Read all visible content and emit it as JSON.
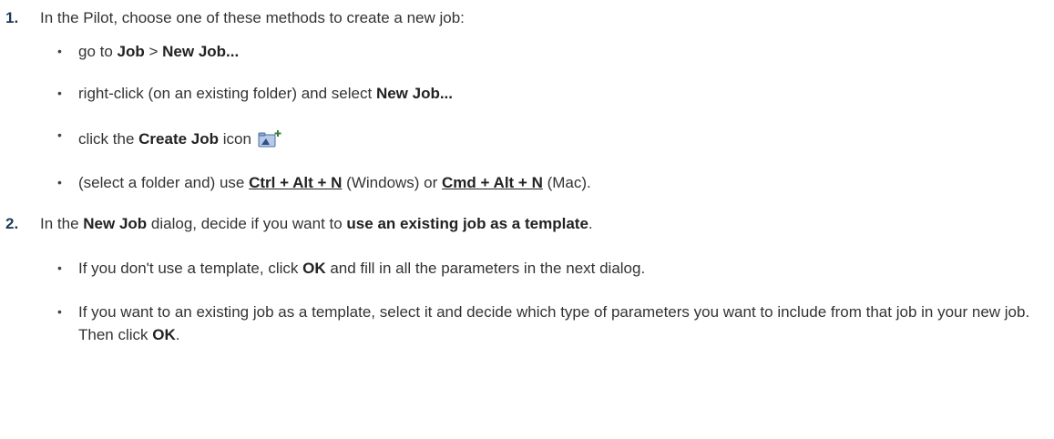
{
  "steps": [
    {
      "number": "1.",
      "text": "In the Pilot, choose one of these methods to create a new job:",
      "bullets": [
        {
          "parts": [
            {
              "t": "go to ",
              "s": "plain"
            },
            {
              "t": "Job",
              "s": "bold"
            },
            {
              "t": " > ",
              "s": "plain"
            },
            {
              "t": "New Job...",
              "s": "bold"
            }
          ]
        },
        {
          "parts": [
            {
              "t": "right-click (on an existing folder) and select ",
              "s": "plain"
            },
            {
              "t": "New Job...",
              "s": "bold"
            }
          ]
        },
        {
          "parts": [
            {
              "t": "click the ",
              "s": "plain"
            },
            {
              "t": "Create Job",
              "s": "bold"
            },
            {
              "t": " icon ",
              "s": "plain"
            }
          ],
          "icon": "create-job-icon"
        },
        {
          "parts": [
            {
              "t": "(select a folder and) use ",
              "s": "plain"
            },
            {
              "t": "Ctrl + Alt + N",
              "s": "kbd"
            },
            {
              "t": " (Windows) or ",
              "s": "plain"
            },
            {
              "t": "Cmd + Alt + N",
              "s": "kbd"
            },
            {
              "t": " (Mac).",
              "s": "plain"
            }
          ]
        }
      ]
    },
    {
      "number": "2.",
      "parts": [
        {
          "t": "In the ",
          "s": "plain"
        },
        {
          "t": "New Job",
          "s": "bold"
        },
        {
          "t": " dialog, decide if you want to ",
          "s": "plain"
        },
        {
          "t": "use an existing job as a template",
          "s": "bold"
        },
        {
          "t": ".",
          "s": "plain"
        }
      ],
      "bullets": [
        {
          "parts": [
            {
              "t": "If you don't use a template, click ",
              "s": "plain"
            },
            {
              "t": "OK",
              "s": "bold"
            },
            {
              "t": " and fill in all the parameters in the next dialog.",
              "s": "plain"
            }
          ]
        },
        {
          "parts": [
            {
              "t": "If you want to an existing job as a template, select it and decide which type of parameters you want to include from that job in your new job. Then click ",
              "s": "plain"
            },
            {
              "t": "OK",
              "s": "bold"
            },
            {
              "t": ".",
              "s": "plain"
            }
          ]
        }
      ]
    }
  ],
  "bullet_glyph": "•",
  "colors": {
    "text": "#333333",
    "step_number": "#1e3a5c",
    "icon_folder": "#6b8fbf",
    "icon_plus": "#3a7d3a"
  }
}
